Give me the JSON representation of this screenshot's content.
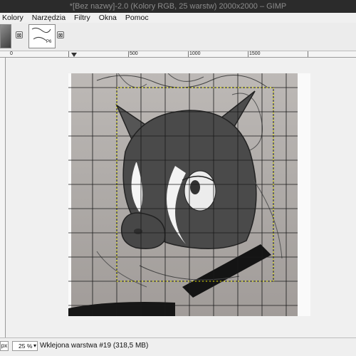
{
  "window": {
    "title": "*[Bez nazwy]-2.0 (Kolory RGB, 25 warstw) 2000x2000 – GIMP"
  },
  "menu": {
    "items": [
      "Kolory",
      "Narzędzia",
      "Filtry",
      "Okna",
      "Pomoc"
    ]
  },
  "tabs": [
    {
      "close": "⊠"
    },
    {
      "close": "⊠",
      "thumb_text": "P6"
    }
  ],
  "ruler": {
    "labels": [
      "0",
      "500",
      "1000",
      "1500"
    ]
  },
  "statusbar": {
    "unit": "px",
    "zoom": "25 %",
    "layer_info": "Wklejona warstwa #19 (318,5 MB)"
  },
  "icons": [
    "close-icon",
    "dropdown-arrow-icon"
  ]
}
